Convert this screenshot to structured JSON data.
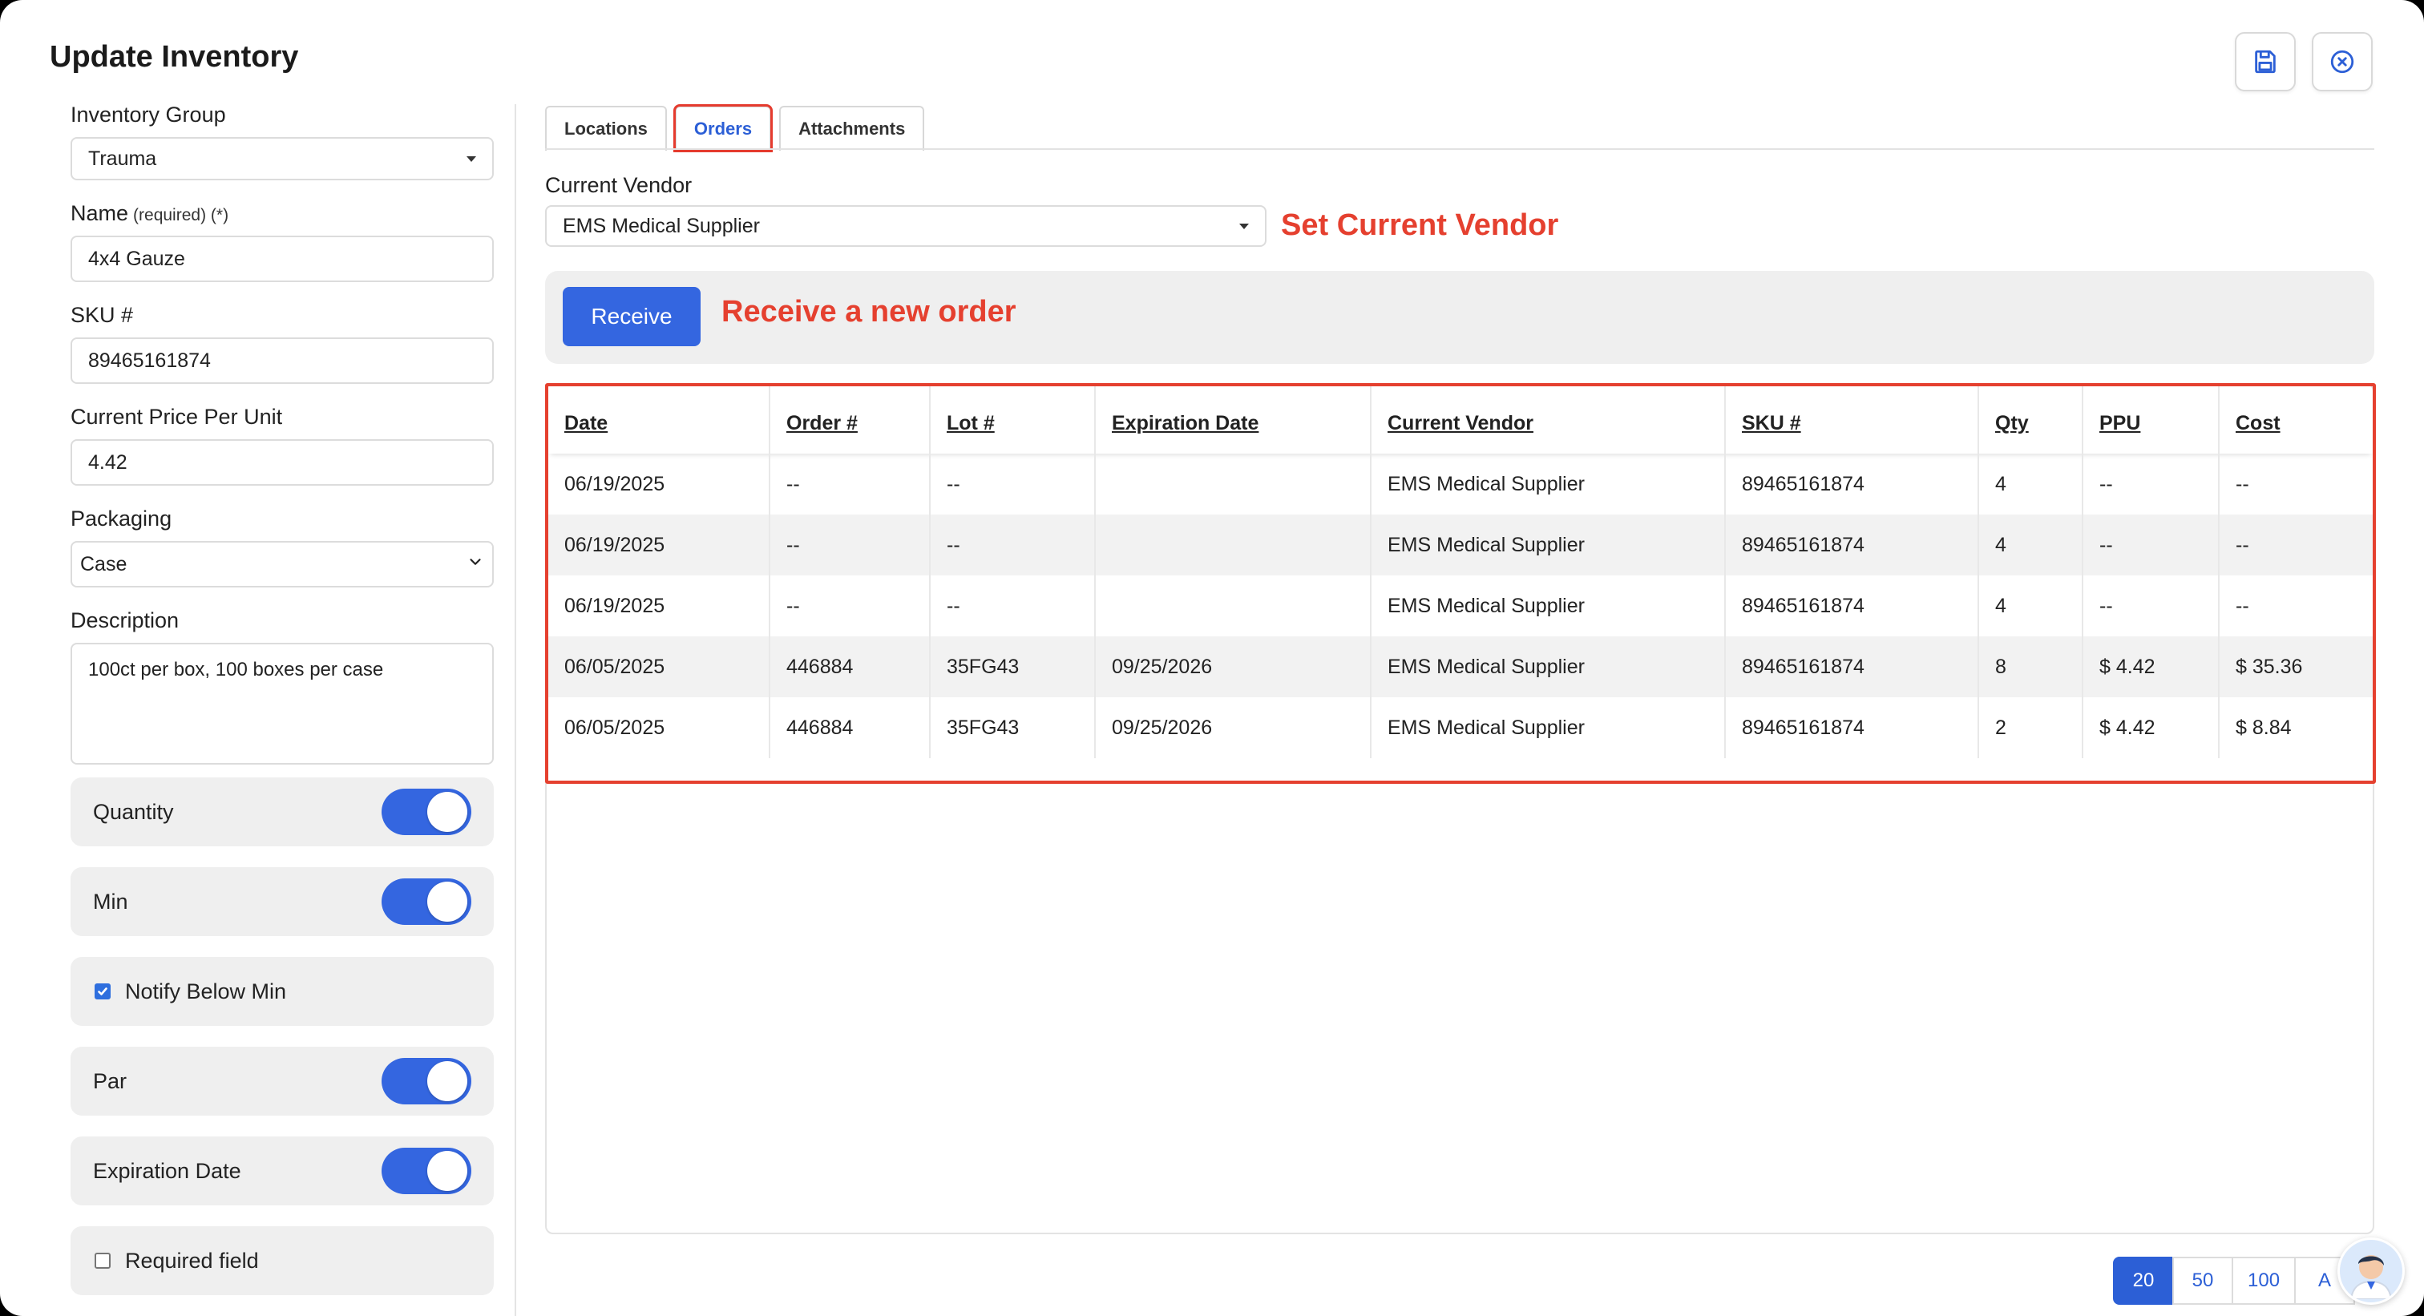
{
  "app": {
    "title": "Update Inventory"
  },
  "toolbar": {
    "save_icon": "save-icon",
    "close_icon": "close-circle-icon"
  },
  "form": {
    "inventory_group": {
      "label": "Inventory Group",
      "value": "Trauma"
    },
    "name": {
      "label": "Name",
      "required_note": "(required) (*)",
      "value": "4x4 Gauze"
    },
    "sku": {
      "label": "SKU #",
      "value": "89465161874"
    },
    "price": {
      "label": "Current Price Per Unit",
      "value": "4.42"
    },
    "packaging": {
      "label": "Packaging",
      "value": "Case"
    },
    "description": {
      "label": "Description",
      "value": "100ct per box, 100 boxes per case"
    },
    "toggles": {
      "quantity": {
        "label": "Quantity",
        "on": true
      },
      "min": {
        "label": "Min",
        "on": true
      },
      "notify": {
        "label": "Notify Below Min",
        "checked": true
      },
      "par": {
        "label": "Par",
        "on": true
      },
      "expiration": {
        "label": "Expiration Date",
        "on": true
      },
      "required": {
        "label": "Required field",
        "checked": false
      }
    }
  },
  "tabs": [
    {
      "label": "Locations",
      "active": false
    },
    {
      "label": "Orders",
      "active": true
    },
    {
      "label": "Attachments",
      "active": false
    }
  ],
  "vendor": {
    "label": "Current Vendor",
    "value": "EMS Medical Supplier",
    "annotation": "Set Current Vendor"
  },
  "receive": {
    "button_label": "Receive",
    "annotation": "Receive a new order"
  },
  "orders": {
    "columns": [
      "Date",
      "Order #",
      "Lot #",
      "Expiration Date",
      "Current Vendor",
      "SKU #",
      "Qty",
      "PPU",
      "Cost"
    ],
    "rows": [
      [
        "06/19/2025",
        "--",
        "--",
        "",
        "EMS Medical Supplier",
        "89465161874",
        "4",
        "--",
        "--"
      ],
      [
        "06/19/2025",
        "--",
        "--",
        "",
        "EMS Medical Supplier",
        "89465161874",
        "4",
        "--",
        "--"
      ],
      [
        "06/19/2025",
        "--",
        "--",
        "",
        "EMS Medical Supplier",
        "89465161874",
        "4",
        "--",
        "--"
      ],
      [
        "06/05/2025",
        "446884",
        "35FG43",
        "09/25/2026",
        "EMS Medical Supplier",
        "89465161874",
        "8",
        "$ 4.42",
        "$ 35.36"
      ],
      [
        "06/05/2025",
        "446884",
        "35FG43",
        "09/25/2026",
        "EMS Medical Supplier",
        "89465161874",
        "2",
        "$ 4.42",
        "$ 8.84"
      ]
    ]
  },
  "pagination": {
    "options": [
      "20",
      "50",
      "100",
      "A"
    ],
    "selected": "20"
  },
  "colors": {
    "accent": "#3466e0",
    "annotation": "#e5402f"
  }
}
